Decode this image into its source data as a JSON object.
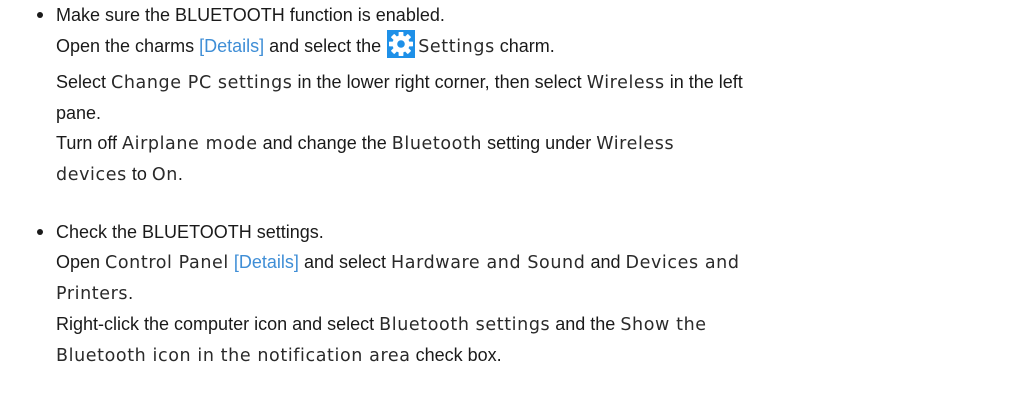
{
  "items": [
    {
      "heading": "Make sure the BLUETOOTH function is enabled.",
      "step1": {
        "pre": "Open the charms ",
        "link": "[Details]",
        "mid": " and select the ",
        "charm": "Settings",
        "post": " charm."
      },
      "step2": {
        "pre": "Select ",
        "ui1": "Change PC settings",
        "mid": " in the lower right corner, then select ",
        "ui2": "Wireless",
        "post": " in the left",
        "cont": "pane."
      },
      "step3": {
        "pre": "Turn off ",
        "ui1": "Airplane mode",
        "mid": " and change the ",
        "ui2": "Bluetooth",
        "mid2": " setting under ",
        "ui3a": "Wireless",
        "ui3b": "devices",
        "mid3": " to ",
        "ui4": "On",
        "post": "."
      }
    },
    {
      "heading": "Check the BLUETOOTH settings.",
      "step1": {
        "pre": "Open ",
        "ui1": "Control Panel",
        "link": "[Details]",
        "mid": " and select ",
        "ui2": "Hardware and Sound",
        "mid2": " and ",
        "ui3a": "Devices and",
        "ui3b": "Printers",
        "post": "."
      },
      "step2": {
        "pre": "Right-click the computer icon and select ",
        "ui1": "Bluetooth settings",
        "mid": " and the ",
        "ui2a": "Show the",
        "ui2b": "Bluetooth icon in the notification area",
        "post": " check box."
      }
    }
  ],
  "icons": {
    "settings_charm": "gear-icon",
    "settings_charm_bg": "#1e90e8",
    "settings_charm_fg": "#ffffff"
  },
  "colors": {
    "text": "#1a1a1a",
    "link": "#3f8ed6"
  }
}
